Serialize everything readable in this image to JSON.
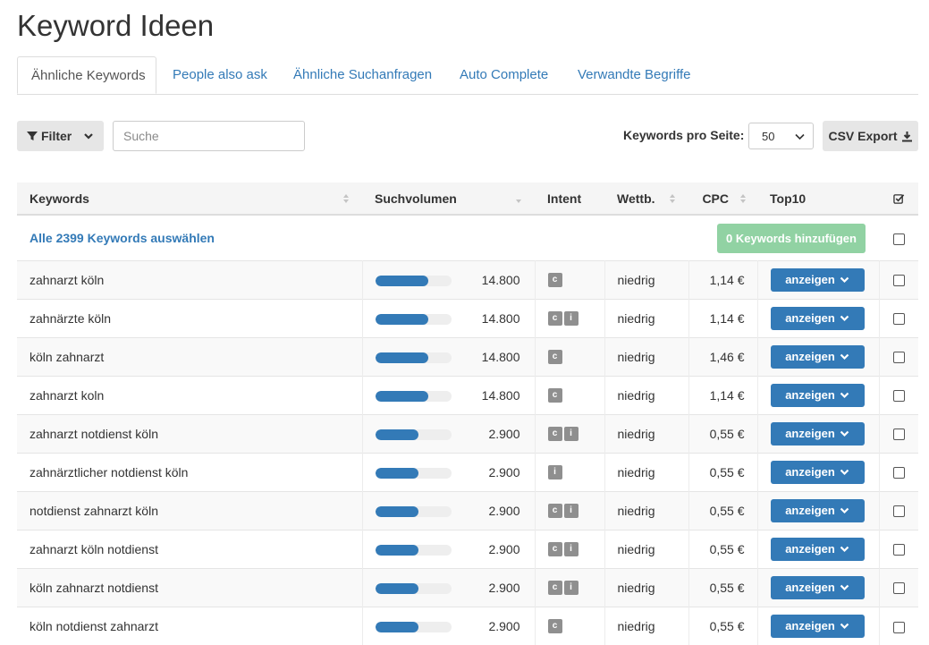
{
  "page": {
    "title": "Keyword Ideen"
  },
  "tabs": [
    {
      "label": "Ähnliche Keywords",
      "active": true
    },
    {
      "label": "People also ask",
      "active": false
    },
    {
      "label": "Ähnliche Suchanfragen",
      "active": false
    },
    {
      "label": "Auto Complete",
      "active": false
    },
    {
      "label": "Verwandte Begriffe",
      "active": false
    }
  ],
  "toolbar": {
    "filter_label": "Filter",
    "search_placeholder": "Suche",
    "keywords_per_page_label": "Keywords pro Seite:",
    "keywords_per_page_value": "50",
    "csv_export_label": "CSV Export"
  },
  "table": {
    "headers": {
      "keywords": "Keywords",
      "volume": "Suchvolumen",
      "intent": "Intent",
      "competition": "Wettb.",
      "cpc": "CPC",
      "top10": "Top10"
    },
    "select_all_label": "Alle 2399 Keywords auswählen",
    "add_button_label": "0 Keywords hinzufügen",
    "show_button_label": "anzeigen",
    "rows": [
      {
        "keyword": "zahnarzt köln",
        "volume": "14.800",
        "volume_share": 0.7,
        "intent": [
          "c"
        ],
        "competition": "niedrig",
        "cpc": "1,14 €"
      },
      {
        "keyword": "zahnärzte köln",
        "volume": "14.800",
        "volume_share": 0.7,
        "intent": [
          "c",
          "i"
        ],
        "competition": "niedrig",
        "cpc": "1,14 €"
      },
      {
        "keyword": "köln zahnarzt",
        "volume": "14.800",
        "volume_share": 0.7,
        "intent": [
          "c"
        ],
        "competition": "niedrig",
        "cpc": "1,46 €"
      },
      {
        "keyword": "zahnarzt koln",
        "volume": "14.800",
        "volume_share": 0.7,
        "intent": [
          "c"
        ],
        "competition": "niedrig",
        "cpc": "1,14 €"
      },
      {
        "keyword": "zahnarzt notdienst köln",
        "volume": "2.900",
        "volume_share": 0.57,
        "intent": [
          "c",
          "i"
        ],
        "competition": "niedrig",
        "cpc": "0,55 €"
      },
      {
        "keyword": "zahnärztlicher notdienst köln",
        "volume": "2.900",
        "volume_share": 0.57,
        "intent": [
          "i"
        ],
        "competition": "niedrig",
        "cpc": "0,55 €"
      },
      {
        "keyword": "notdienst zahnarzt köln",
        "volume": "2.900",
        "volume_share": 0.57,
        "intent": [
          "c",
          "i"
        ],
        "competition": "niedrig",
        "cpc": "0,55 €"
      },
      {
        "keyword": "zahnarzt köln notdienst",
        "volume": "2.900",
        "volume_share": 0.57,
        "intent": [
          "c",
          "i"
        ],
        "competition": "niedrig",
        "cpc": "0,55 €"
      },
      {
        "keyword": "köln zahnarzt notdienst",
        "volume": "2.900",
        "volume_share": 0.57,
        "intent": [
          "c",
          "i"
        ],
        "competition": "niedrig",
        "cpc": "0,55 €"
      },
      {
        "keyword": "köln notdienst zahnarzt",
        "volume": "2.900",
        "volume_share": 0.57,
        "intent": [
          "c"
        ],
        "competition": "niedrig",
        "cpc": "0,55 €"
      }
    ]
  },
  "colors": {
    "primary": "#337ab7",
    "success_disabled": "#91d2a3",
    "badge": "#8f8f8f",
    "bar_track": "#eeeeee"
  },
  "icons": {
    "filter": "filter-icon",
    "chevron": "chevron-down-icon",
    "download": "download-icon",
    "sort": "sort-icon",
    "check_all": "checkbox-checked-icon"
  }
}
